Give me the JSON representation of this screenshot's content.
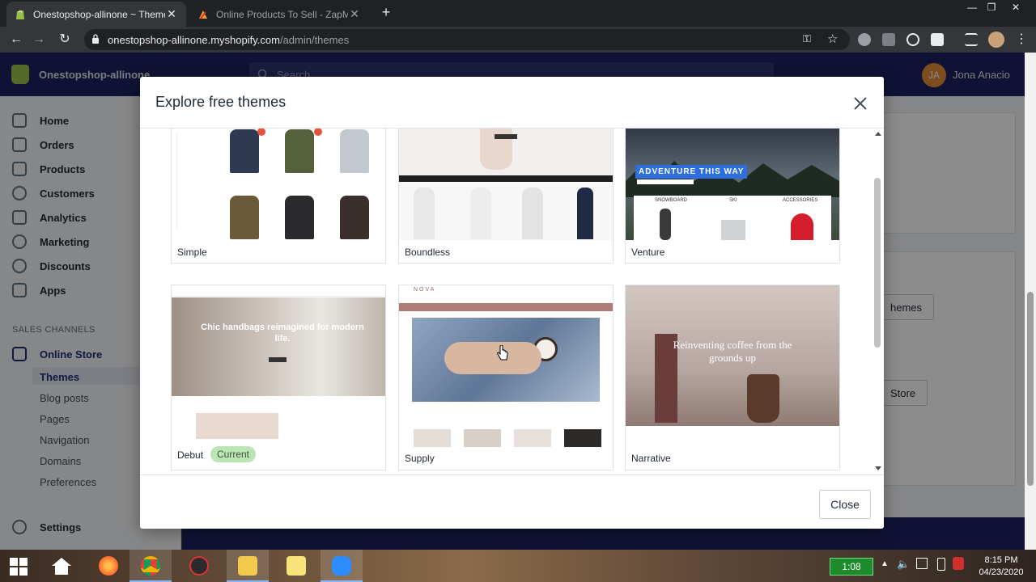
{
  "browser": {
    "tabs": [
      {
        "title": "Onestopshop-allinone ~ Themes",
        "active": true
      },
      {
        "title": "Online Products To Sell - ZapMe",
        "active": false
      }
    ],
    "url_host": "onestopshop-allinone.myshopify.com",
    "url_path": "/admin/themes"
  },
  "admin": {
    "store_name": "Onestopshop-allinone",
    "search_placeholder": "Search",
    "user_initials": "JA",
    "user_name": "Jona Anacio",
    "nav": [
      {
        "label": "Home",
        "icon": "home-icon"
      },
      {
        "label": "Orders",
        "icon": "orders-icon"
      },
      {
        "label": "Products",
        "icon": "tag-icon"
      },
      {
        "label": "Customers",
        "icon": "person-icon"
      },
      {
        "label": "Analytics",
        "icon": "bar-chart-icon"
      },
      {
        "label": "Marketing",
        "icon": "target-icon"
      },
      {
        "label": "Discounts",
        "icon": "discount-icon"
      },
      {
        "label": "Apps",
        "icon": "apps-icon"
      }
    ],
    "sales_channels_label": "SALES CHANNELS",
    "online_store_label": "Online Store",
    "online_store_sub": [
      "Themes",
      "Blog posts",
      "Pages",
      "Navigation",
      "Domains",
      "Preferences"
    ],
    "settings_label": "Settings",
    "main_buttons": [
      "hemes",
      "Store"
    ]
  },
  "modal": {
    "title": "Explore free themes",
    "close_label": "Close",
    "current_badge": "Current",
    "themes": [
      {
        "name": "Simple"
      },
      {
        "name": "Boundless"
      },
      {
        "name": "Venture",
        "banner": "ADVENTURE THIS WAY",
        "categories": [
          "SNOWBOARD",
          "SKI",
          "ACCESSORIES"
        ]
      },
      {
        "name": "Debut",
        "headline": "Chic handbags reimagined for modern life.",
        "current": true
      },
      {
        "name": "Supply",
        "brand": "NOVA"
      },
      {
        "name": "Narrative",
        "headline": "Reinventing coffee from the grounds up"
      }
    ]
  },
  "taskbar": {
    "timer": "1:08",
    "time": "8:15 PM",
    "date": "04/23/2020"
  }
}
